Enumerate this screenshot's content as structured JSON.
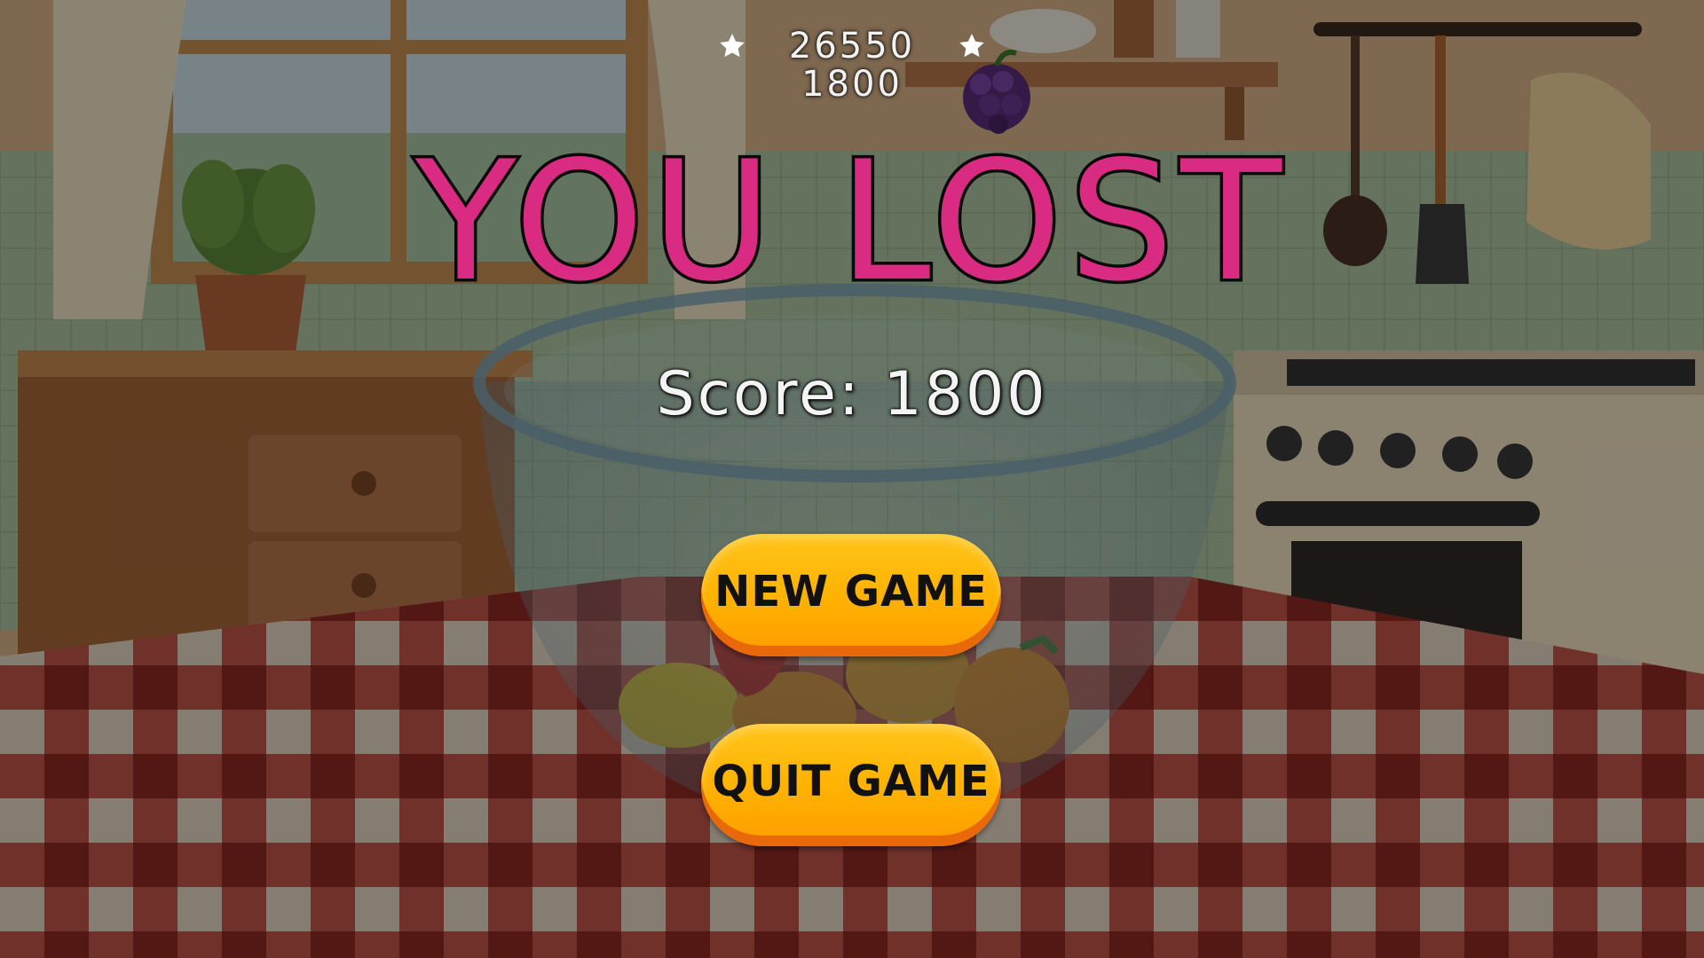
{
  "hud": {
    "best_score": "26550",
    "current_score": "1800",
    "left_icon": "star-icon",
    "right_icon": "star-icon"
  },
  "next_fruit": "blackberry-icon",
  "game_over": {
    "title": "YOU LOST",
    "score_text": "Score: 1800"
  },
  "buttons": {
    "new_game": "NEW GAME",
    "quit_game": "QUIT GAME"
  },
  "colors": {
    "title_fill": "#d92b82",
    "title_outline": "#0b0b0b",
    "button_fill": "#ffb100",
    "button_edge": "#e8680a",
    "overlay": "rgba(0,0,0,0.42)"
  }
}
